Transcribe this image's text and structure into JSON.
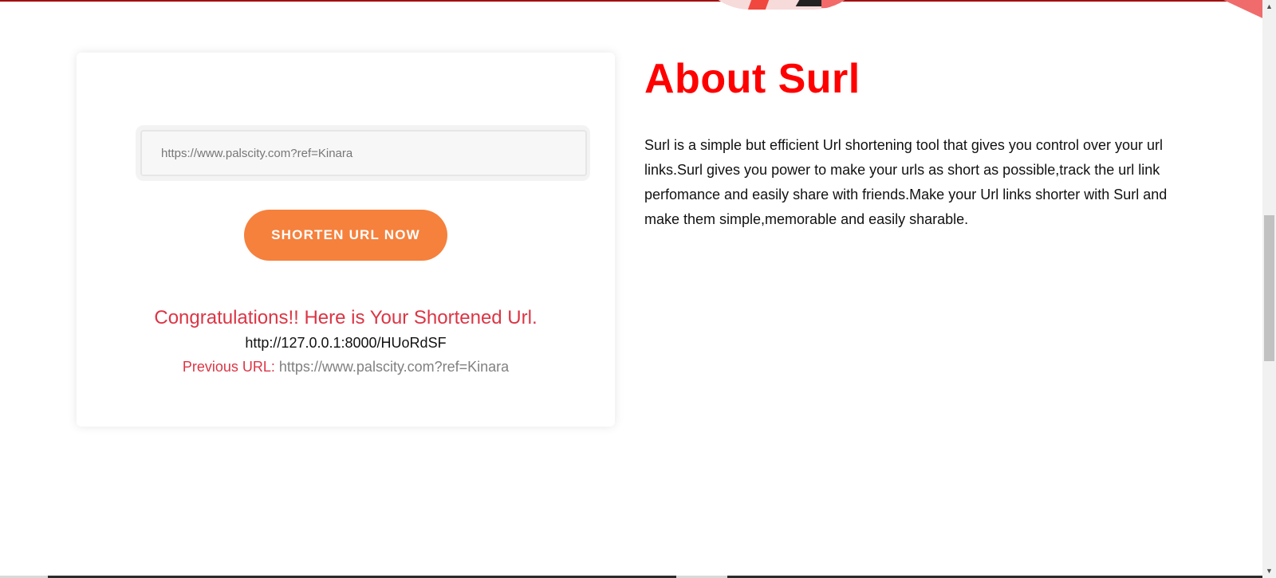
{
  "form": {
    "input_value": "https://www.palscity.com?ref=Kinara",
    "button_label": "SHORTEN URL NOW"
  },
  "result": {
    "congrats_text": "Congratulations!! Here is Your Shortened Url.",
    "short_url": "http://127.0.0.1:8000/HUoRdSF",
    "previous_label": "Previous URL:",
    "previous_url": "https://www.palscity.com?ref=Kinara"
  },
  "about": {
    "title": "About Surl",
    "description": "Surl is a simple but efficient Url shortening tool that gives you control over your url links.Surl gives you power to make your urls as short as possible,track the url link perfomance and easily share with friends.Make your Url links shorter with Surl and make them simple,memorable and easily sharable."
  },
  "scrollbar": {
    "up_icon": "▲",
    "down_icon": "▼"
  },
  "colors": {
    "accent_red": "#ff0000",
    "button_orange": "#f5813d",
    "message_red": "#dc3545"
  }
}
